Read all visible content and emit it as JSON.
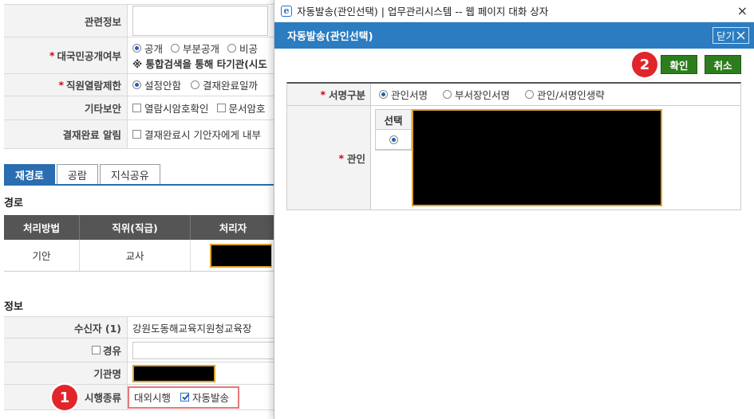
{
  "form": {
    "rows": [
      {
        "label": "관련정보",
        "required": false,
        "lines": []
      },
      {
        "label": "대국민공개여부",
        "required": true,
        "lines": [
          "공개",
          "부분공개",
          "비공",
          "※ 통합검색을 통해 타기관(시도"
        ]
      },
      {
        "label": "직원열람제한",
        "required": true,
        "lines": [
          "설정안함",
          "결재완료일까"
        ]
      },
      {
        "label": "기타보안",
        "required": false,
        "lines": [
          "열람시암호확인",
          "문서암호"
        ]
      },
      {
        "label": "결재완료 알림",
        "required": false,
        "lines": [
          "결재완료시 기안자에게 내부"
        ]
      }
    ]
  },
  "tabs": [
    {
      "label": "재경로",
      "active": true
    },
    {
      "label": "공람",
      "active": false
    },
    {
      "label": "지식공유",
      "active": false
    }
  ],
  "route": {
    "section_title": "경로",
    "headers": [
      "처리방법",
      "직위(직급)",
      "처리자"
    ],
    "row": {
      "method": "기안",
      "position": "교사"
    }
  },
  "recipients": {
    "section_title": "정보",
    "recipient_label": "수신자 (1)",
    "recipient_value": "강원도동해교육지원청교육장",
    "via_label": "경유",
    "org_label": "기관명",
    "send_type_label": "시행종류",
    "send_type_value": "대외시행",
    "auto_send_label": "자동발송",
    "badge_1": "1"
  },
  "dialog": {
    "window_title": "자동발송(관인선택) | 업무관리시스템 -- 웹 페이지 대화 상자",
    "window_close": "×",
    "header_title": "자동발송(관인선택)",
    "close_button": "닫기",
    "confirm_button": "확인",
    "cancel_button": "취소",
    "badge_2": "2",
    "sign_type_label": "서명구분",
    "sign_options": [
      "관인서명",
      "부서장인서명",
      "관인/서명인생략"
    ],
    "sign_selected": 0,
    "seal_label": "관인",
    "select_header": "선택"
  },
  "colors": {
    "dialog_header": "#2b7cc0",
    "action_button": "#2d7d1e",
    "active_tab": "#2a6db0",
    "badge": "#e0262b",
    "required": "#d0021b"
  }
}
